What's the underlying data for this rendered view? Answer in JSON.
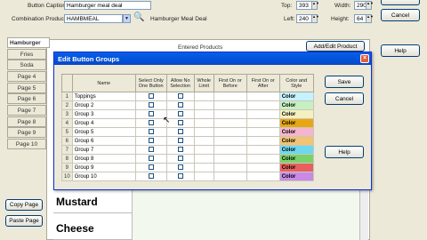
{
  "top": {
    "caption_label": "Button Caption:",
    "caption_value": "Hamburger meal deal",
    "combo_label": "Combination Product:",
    "combo_value": "HAMBMEAL",
    "combo_desc": "Hamburger Meal Deal",
    "top_label": "Top:",
    "top_value": "393",
    "width_label": "Width:",
    "width_value": "290",
    "left_label": "Left:",
    "left_value": "240",
    "height_label": "Height:",
    "height_value": "64",
    "cancel_label": "Cancel"
  },
  "left_tabs": [
    {
      "label": "Hamburger"
    },
    {
      "label": "Fries"
    },
    {
      "label": "Soda"
    },
    {
      "label": "Page 4"
    },
    {
      "label": "Page 5"
    },
    {
      "label": "Page 6"
    },
    {
      "label": "Page 7"
    },
    {
      "label": "Page 8"
    },
    {
      "label": "Page 9"
    },
    {
      "label": "Page 10"
    }
  ],
  "left_buttons": {
    "copy": "Copy Page",
    "paste": "Paste Page"
  },
  "main": {
    "products_label": "Entered Products",
    "add_edit_label": "Add/Edit Product",
    "help_label": "Help",
    "food_rows": [
      "Mustard",
      "Cheese"
    ]
  },
  "dialog": {
    "title": "Edit Button Groups",
    "close": "×",
    "headers": {
      "name": "Name",
      "select_only": "Select Only One Button",
      "allow_no": "Allow No Selection",
      "whole": "Whole Limit",
      "first_before": "First On or Before",
      "first_after": "First On or After",
      "color": "Color and Style"
    },
    "rows": [
      {
        "n": "1",
        "name": "Toppings",
        "color": "#c6f2ff",
        "color_label": "Color"
      },
      {
        "n": "2",
        "name": "Group 2",
        "color": "#c5f0c1",
        "color_label": "Color"
      },
      {
        "n": "3",
        "name": "Group 3",
        "color": "#f4f0c0",
        "color_label": "Color"
      },
      {
        "n": "4",
        "name": "Group 4",
        "color": "#e8a712",
        "color_label": "Color"
      },
      {
        "n": "5",
        "name": "Group 5",
        "color": "#f4b6cf",
        "color_label": "Color"
      },
      {
        "n": "6",
        "name": "Group 6",
        "color": "#f3c374",
        "color_label": "Color"
      },
      {
        "n": "7",
        "name": "Group 7",
        "color": "#6fd8ef",
        "color_label": "Color"
      },
      {
        "n": "8",
        "name": "Group 8",
        "color": "#7ad36a",
        "color_label": "Color"
      },
      {
        "n": "9",
        "name": "Group 9",
        "color": "#e85f5f",
        "color_label": "Color"
      },
      {
        "n": "10",
        "name": "Group 10",
        "color": "#c98ae6",
        "color_label": "Color"
      }
    ],
    "save_label": "Save",
    "cancel_label": "Cancel",
    "help_label": "Help"
  }
}
